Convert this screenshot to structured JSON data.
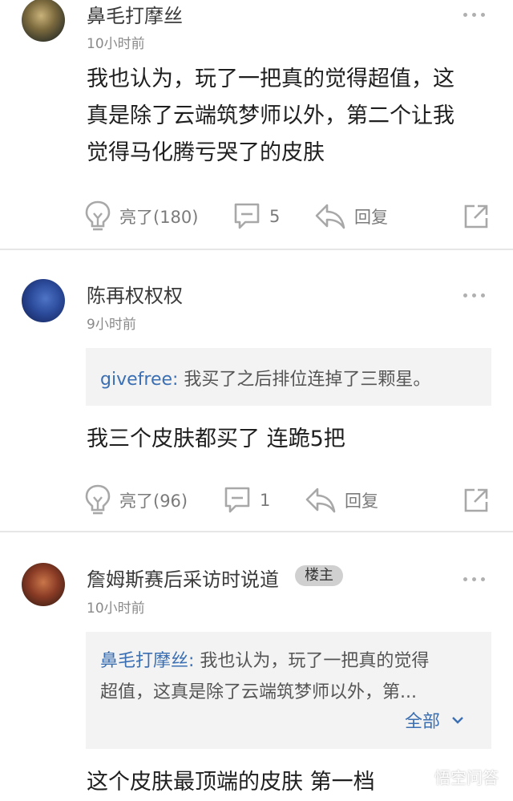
{
  "comments": [
    {
      "username": "鼻毛打摩丝",
      "time": "10小时前",
      "body_lines": [
        "我也认为，玩了一把真的觉得超值，这",
        "真是除了云端筑梦师以外，第二个让我",
        "觉得马化腾亏哭了的皮肤"
      ],
      "like_label": "亮了(180)",
      "reply_count": "5",
      "reply_label": "回复",
      "avatar_icon": "avatar-photo"
    },
    {
      "username": "陈再权权权",
      "time": "9小时前",
      "quote_author": "givefree:",
      "quote_text": " 我买了之后排位连掉了三颗星。",
      "body_lines": [
        "我三个皮肤都买了 连跪5把"
      ],
      "like_label": "亮了(96)",
      "reply_count": "1",
      "reply_label": "回复",
      "avatar_icon": "avatar-photo"
    },
    {
      "username": "詹姆斯赛后采访时说道",
      "badge": "楼主",
      "time": "10小时前",
      "quote_author": "鼻毛打摩丝:",
      "quote_line1": " 我也认为，玩了一把真的觉得",
      "quote_line2": "超值，这真是除了云端筑梦师以外，第...",
      "expand_label": "全部",
      "body_lines": [
        "这个皮肤最顶端的皮肤 第一档"
      ],
      "avatar_icon": "avatar-photo"
    }
  ],
  "watermark": "悟空问答",
  "colors": {
    "link": "#3b6fb3",
    "quote_bg": "#f3f3f3",
    "icon_gray": "#a8a8a8",
    "divider": "#e6e6e6"
  }
}
